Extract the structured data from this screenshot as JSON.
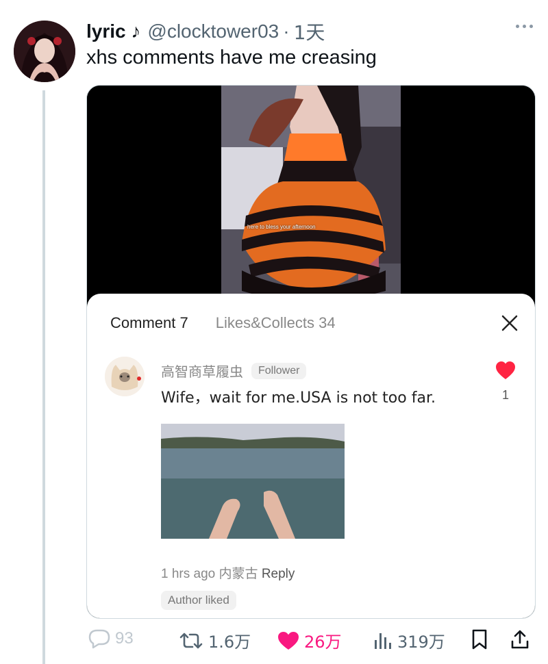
{
  "tweet": {
    "display_name": "lyric ♪",
    "handle": "@clocktower03",
    "separator": "·",
    "time": "1天",
    "text": "xhs comments have me creasing"
  },
  "video": {
    "caption": "here to bless your afternoon"
  },
  "comment_sheet": {
    "tab_comments": "Comment 7",
    "tab_likes": "Likes&Collects 34",
    "comment": {
      "username": "高智商草履虫",
      "badge": "Follower",
      "text": "Wife，wait for me.USA is not too far.",
      "like_count": "1",
      "time_ago": "1 hrs ago",
      "location": "内蒙古",
      "reply_label": "Reply",
      "author_liked": "Author liked"
    }
  },
  "actions": {
    "replies": "93",
    "retweets": "1.6万",
    "likes": "26万",
    "views": "319万"
  },
  "colors": {
    "like_pink": "#f91880",
    "xhs_red": "#ff2442",
    "secondary_text": "#536471",
    "thread_line": "#cfd9de"
  }
}
